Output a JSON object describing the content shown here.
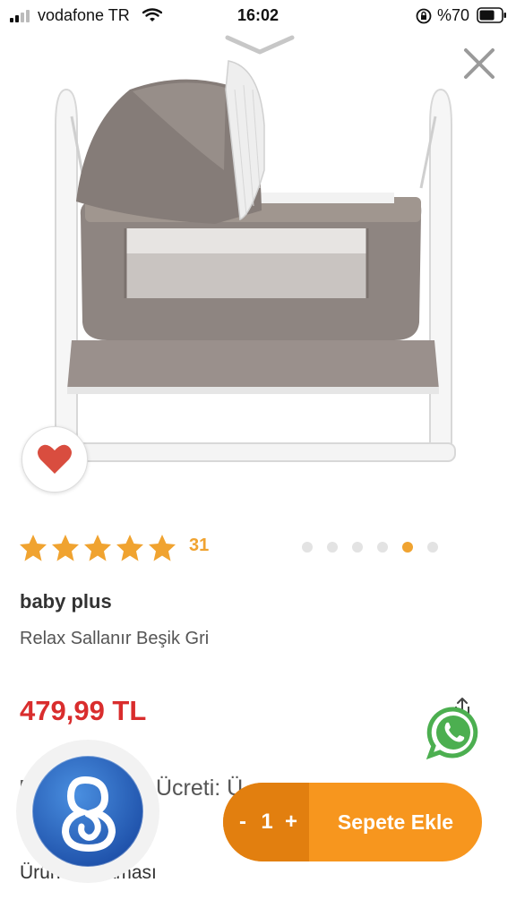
{
  "status_bar": {
    "carrier": "vodafone TR",
    "time": "16:02",
    "battery_percent": "%70",
    "battery_level": 0.7
  },
  "product": {
    "brand": "baby plus",
    "name": "Relax Sallanır Beşik Gri",
    "price": "479,99 TL",
    "rating_value": 5,
    "review_count": "31",
    "image_count": 6,
    "active_image_index": 4
  },
  "shipping": {
    "label": "Ücreti: Ü"
  },
  "description": {
    "title": "Ürün Açıklaması"
  },
  "cart": {
    "minus": "-",
    "quantity": "1",
    "plus": "+",
    "add_label": "Sepete Ekle"
  },
  "colors": {
    "accent_orange": "#f7961e",
    "price_red": "#d92d2d",
    "star_orange": "#f0a330",
    "whatsapp_green": "#4caf50"
  }
}
